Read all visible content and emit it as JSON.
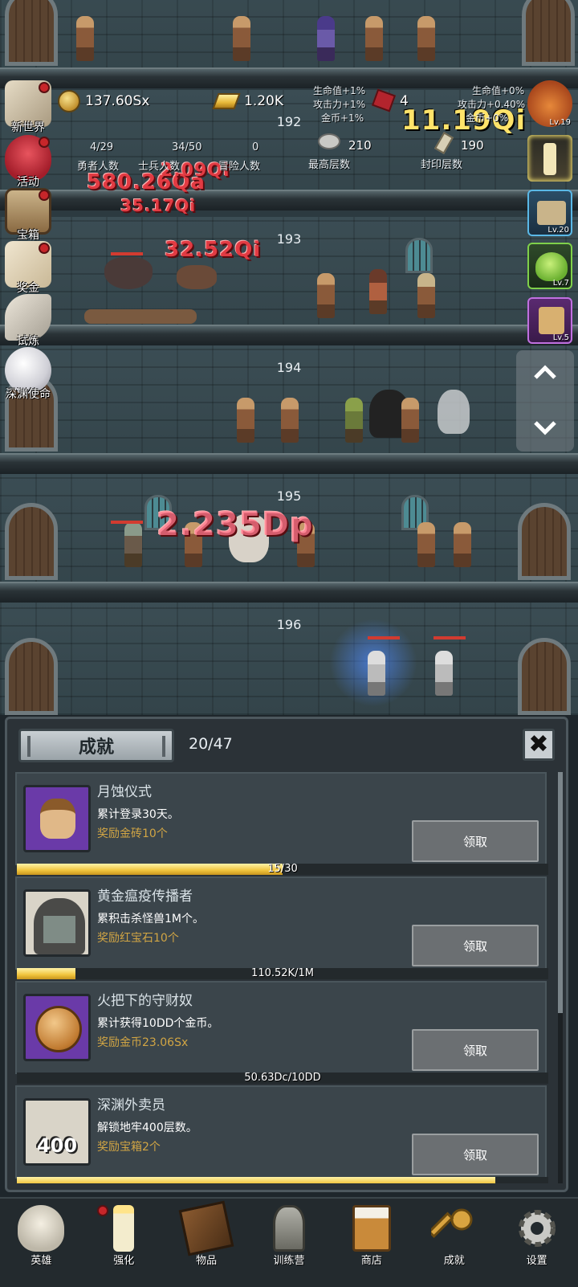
{
  "hud": {
    "gold": "137.60Sx",
    "brick": "1.20K",
    "ruby": "4",
    "left_bonus": [
      "生命值+1%",
      "攻击力+1%",
      "金币+1%"
    ],
    "right_bonus": [
      "生命值+0%",
      "攻击力+0.40%",
      "金币+0%"
    ],
    "counts": [
      {
        "label": "勇者人数",
        "value": "4/29"
      },
      {
        "label": "士兵人数",
        "value": "34/50"
      },
      {
        "label": "冒险人数",
        "value": "0"
      }
    ],
    "max_floor": {
      "label": "最高层数",
      "value": "210"
    },
    "seal_floor": {
      "label": "封印层数",
      "value": "190"
    }
  },
  "floors": [
    "192",
    "193",
    "194",
    "195",
    "196"
  ],
  "damage_texts": [
    "11.19Qi",
    "580.26Qa",
    "2.09Qi",
    "35.17Qi",
    "32.52Qi",
    "2.235Dp"
  ],
  "left_menu": [
    {
      "label": "新世界",
      "icon": "map-icon",
      "dot": true
    },
    {
      "label": "活动",
      "icon": "heart-icon",
      "dot": true
    },
    {
      "label": "宝箱",
      "icon": "chest-icon",
      "dot": true
    },
    {
      "label": "奖金",
      "icon": "envelope-icon",
      "dot": true
    },
    {
      "label": "试炼",
      "icon": "feather-icon",
      "dot": false
    },
    {
      "label": "深渊使命",
      "icon": "pearl-icon",
      "dot": false
    }
  ],
  "right_items": [
    {
      "icon": "pumpkin-icon",
      "level": "Lv.19"
    },
    {
      "icon": "candle-icon",
      "level": ""
    },
    {
      "icon": "box-icon",
      "level": "Lv.20"
    },
    {
      "icon": "slime-icon",
      "level": "Lv.7"
    },
    {
      "icon": "frame-icon",
      "level": "Lv.5"
    }
  ],
  "panel": {
    "title": "成就",
    "count": "20/47",
    "close_icon": "close-icon"
  },
  "achievements": [
    {
      "name": "月蚀仪式",
      "desc": "累计登录30天。",
      "reward": "奖励金砖10个",
      "button": "领取",
      "progress_text": "15/30",
      "progress": 0.5,
      "avatar_bg": "#6a3aa8",
      "icon": "hero-portrait-icon"
    },
    {
      "name": "黄金瘟疫传播者",
      "desc": "累积击杀怪兽1M个。",
      "reward": "奖励红宝石10个",
      "button": "领取",
      "progress_text": "110.52K/1M",
      "progress": 0.11,
      "avatar_bg": "#d9d4c8",
      "icon": "hooded-figure-icon"
    },
    {
      "name": "火把下的守财奴",
      "desc": "累计获得10DD个金币。",
      "reward": "奖励金币23.06Sx",
      "button": "领取",
      "progress_text": "50.63Dc/10DD",
      "progress": 0.0,
      "avatar_bg": "#6a3aa8",
      "icon": "gold-coin-icon"
    },
    {
      "name": "深渊外卖员",
      "desc": "解锁地牢400层数。",
      "reward": "奖励宝箱2个",
      "button": "领取",
      "progress_text": "",
      "progress": 0.9,
      "avatar_bg": "#d9d4c8",
      "icon": "map-400-icon",
      "avatar_text": "400"
    }
  ],
  "nav": [
    {
      "label": "英雄",
      "icon": "skull-icon",
      "dot": false
    },
    {
      "label": "强化",
      "icon": "candle-icon",
      "dot": true
    },
    {
      "label": "物品",
      "icon": "book-icon",
      "dot": false
    },
    {
      "label": "训练营",
      "icon": "lantern-icon",
      "dot": false
    },
    {
      "label": "商店",
      "icon": "beer-mug-icon",
      "dot": false
    },
    {
      "label": "成就",
      "icon": "key-icon",
      "dot": false
    },
    {
      "label": "设置",
      "icon": "gear-icon",
      "dot": false
    }
  ]
}
